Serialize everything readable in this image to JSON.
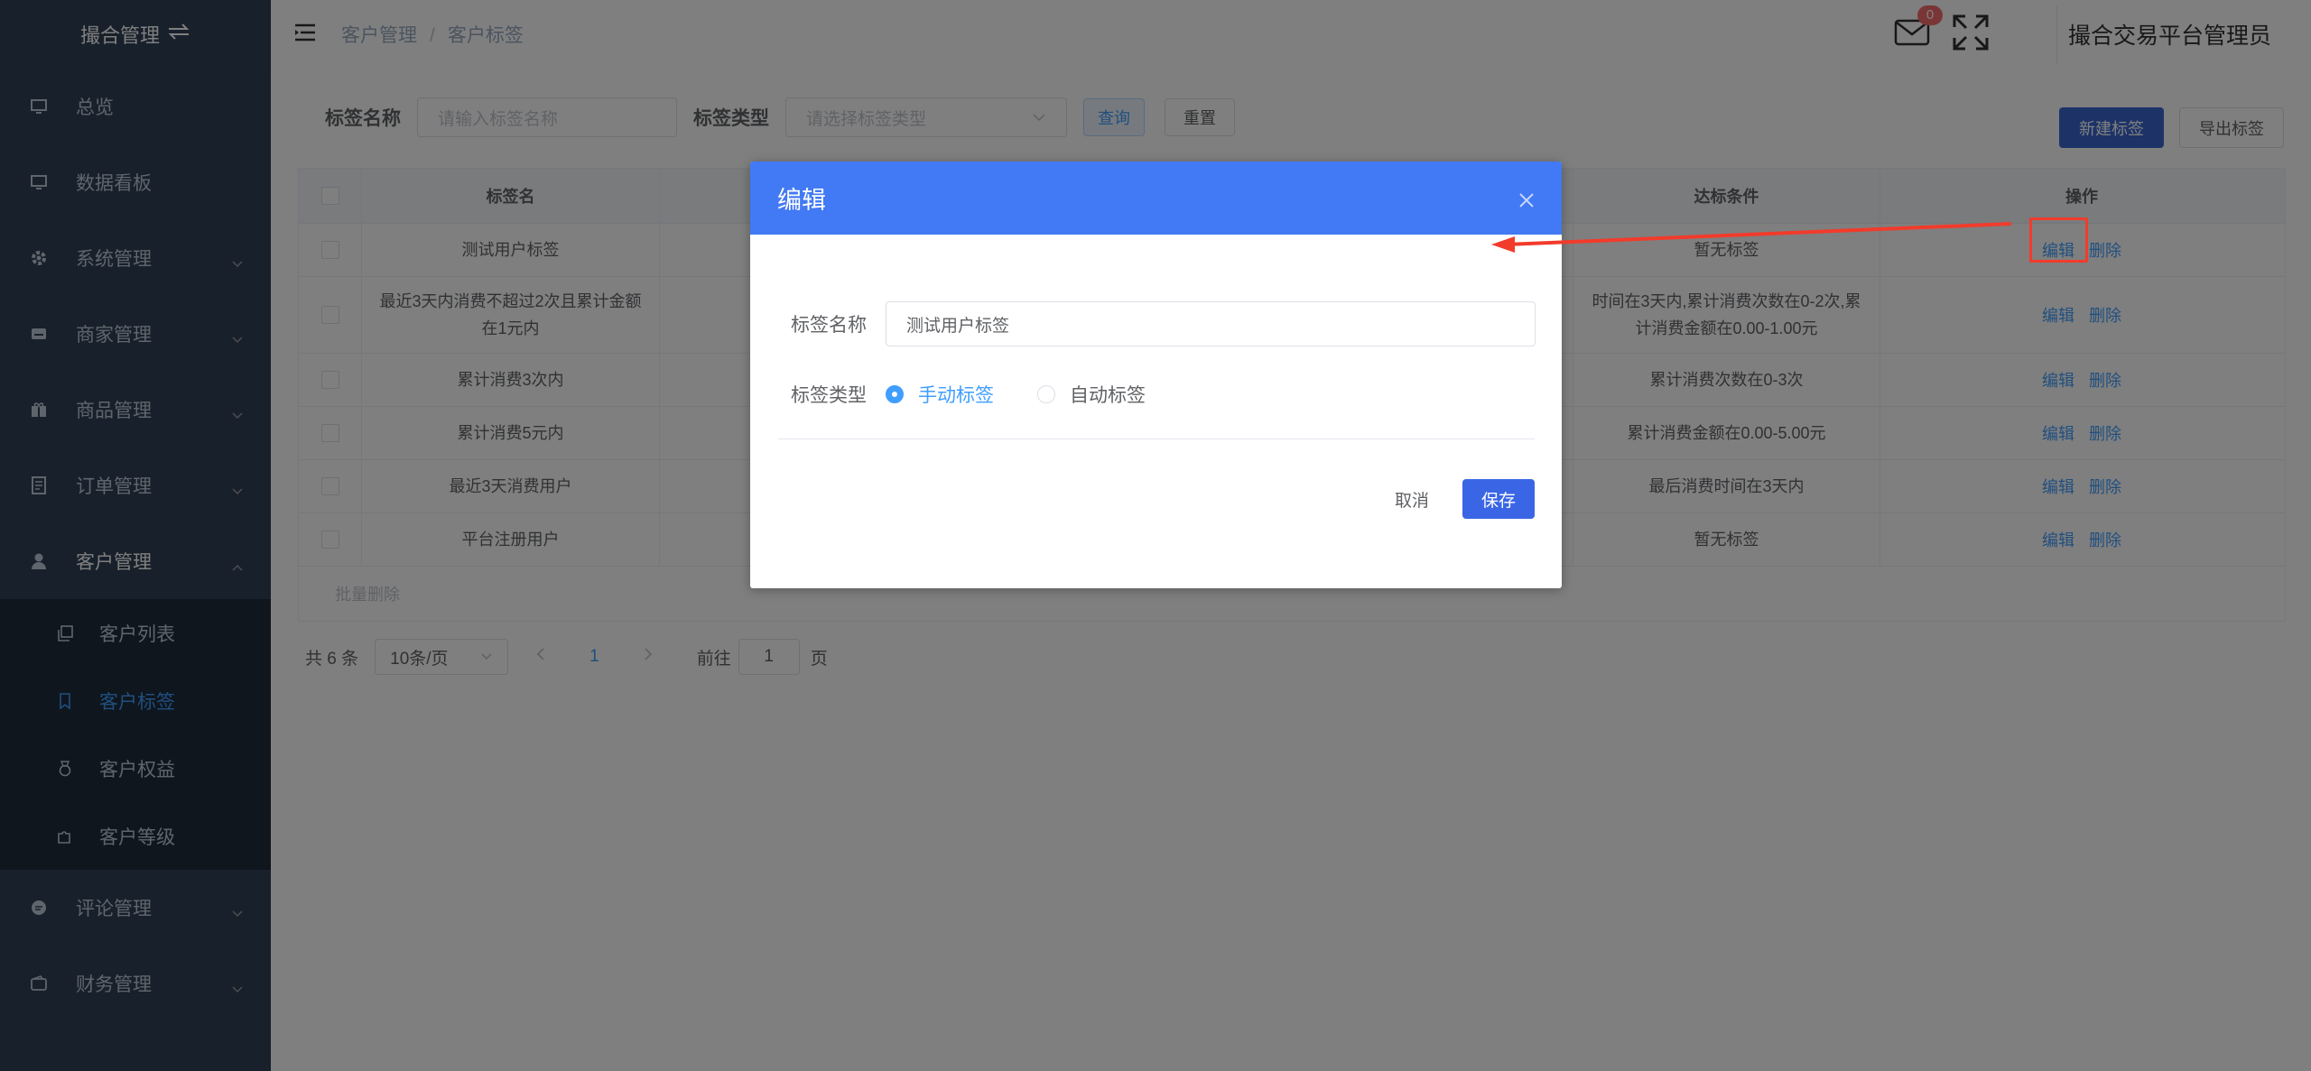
{
  "sidebar": {
    "brand": "撮合管理",
    "items": [
      {
        "label": "总览",
        "icon": "monitor-icon"
      },
      {
        "label": "数据看板",
        "icon": "monitor-icon"
      },
      {
        "label": "系统管理",
        "icon": "gear-icon"
      },
      {
        "label": "商家管理",
        "icon": "store-icon"
      },
      {
        "label": "商品管理",
        "icon": "gift-icon"
      },
      {
        "label": "订单管理",
        "icon": "document-icon"
      },
      {
        "label": "客户管理",
        "icon": "user-icon"
      }
    ],
    "sub_items": [
      {
        "label": "客户列表",
        "icon": "copy-icon"
      },
      {
        "label": "客户标签",
        "icon": "bookmark-icon"
      },
      {
        "label": "客户权益",
        "icon": "medal-icon"
      },
      {
        "label": "客户等级",
        "icon": "puzzle-icon"
      }
    ],
    "after_items": [
      {
        "label": "评论管理",
        "icon": "chat-icon"
      },
      {
        "label": "财务管理",
        "icon": "wallet-icon"
      }
    ]
  },
  "header": {
    "breadcrumb": [
      "客户管理",
      "客户标签"
    ],
    "mail_badge": "0",
    "username": "撮合交易平台管理员"
  },
  "search": {
    "name_label": "标签名称",
    "name_placeholder": "请输入标签名称",
    "type_label": "标签类型",
    "type_placeholder": "请选择标签类型",
    "query_btn": "查询",
    "reset_btn": "重置",
    "new_btn": "新建标签",
    "export_btn": "导出标签"
  },
  "table": {
    "headers": [
      "标签名",
      "达标条件",
      "操作"
    ],
    "rows": [
      {
        "name": "测试用户标签",
        "cond": "暂无标签"
      },
      {
        "name": "最近3天内消费不超过2次且累计金额在1元内",
        "cond": "时间在3天内,累计消费次数在0-2次,累计消费金额在0.00-1.00元"
      },
      {
        "name": "累计消费3次内",
        "cond": "累计消费次数在0-3次"
      },
      {
        "name": "累计消费5元内",
        "cond": "累计消费金额在0.00-5.00元"
      },
      {
        "name": "最近3天消费用户",
        "cond": "最后消费时间在3天内"
      },
      {
        "name": "平台注册用户",
        "cond": "暂无标签"
      }
    ],
    "edit": "编辑",
    "delete": "删除",
    "batch_delete": "批量删除"
  },
  "pager": {
    "total": "共 6 条",
    "page_size": "10条/页",
    "current": "1",
    "goto_prefix": "前往",
    "goto_value": "1",
    "goto_suffix": "页"
  },
  "dialog": {
    "title": "编辑",
    "name_label": "标签名称",
    "name_value": "测试用户标签",
    "type_label": "标签类型",
    "opt_manual": "手动标签",
    "opt_auto": "自动标签",
    "selected": "手动标签",
    "cancel": "取消",
    "save": "保存"
  },
  "colors": {
    "sidebar_bg": "#304156",
    "accent": "#409eff",
    "dialog_header": "#4279f4",
    "annotation": "#f23b2b"
  }
}
